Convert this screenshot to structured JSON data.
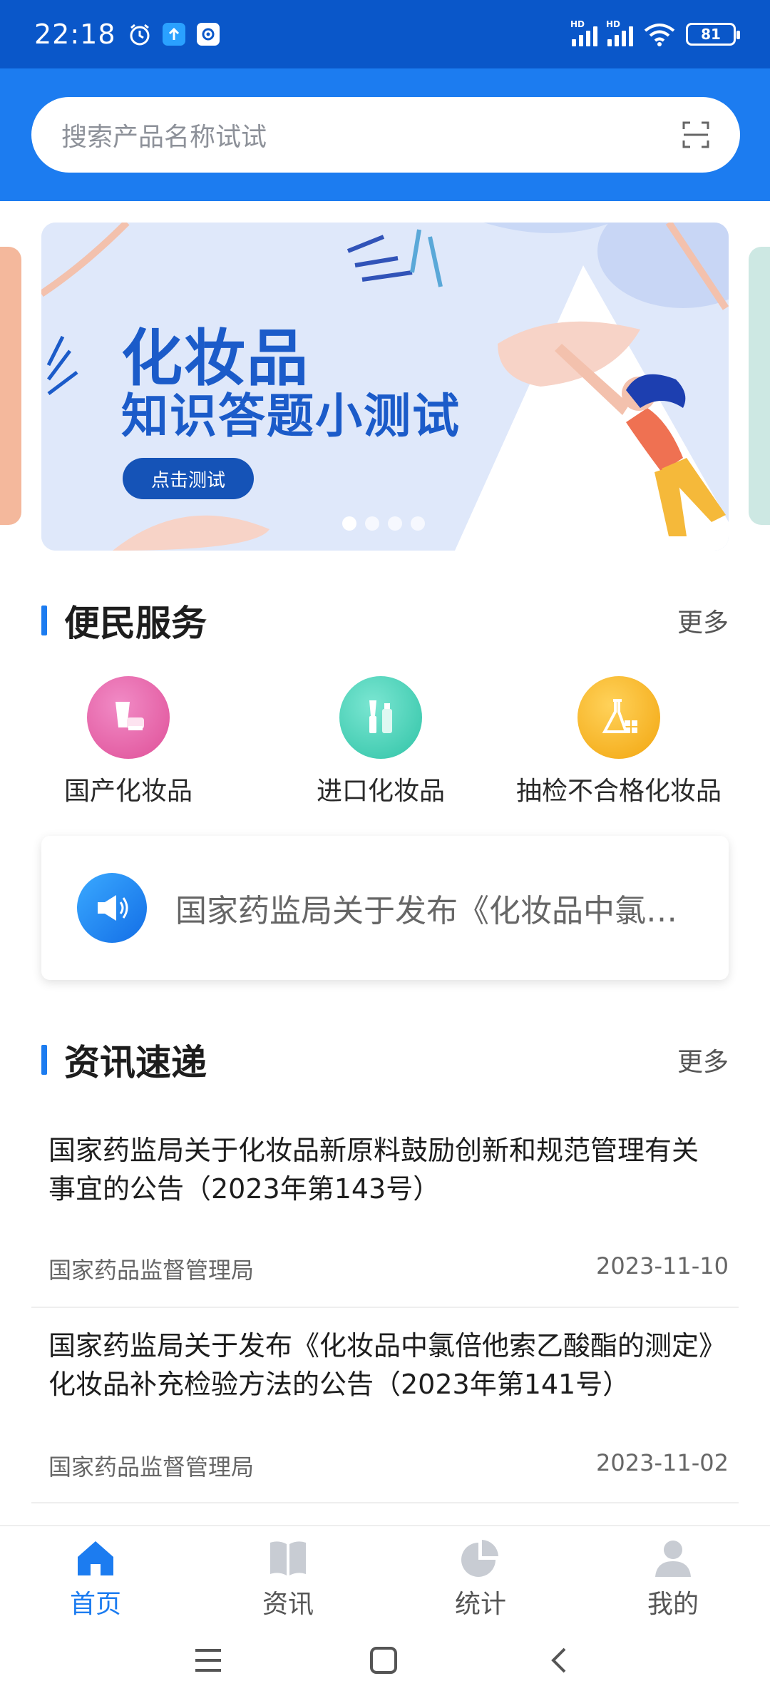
{
  "status_bar": {
    "time": "22:18",
    "battery": "81",
    "signal_label": "HD"
  },
  "search": {
    "placeholder": "搜索产品名称试试",
    "scan_icon": "scan-icon"
  },
  "banner": {
    "title": "化妆品",
    "subtitle": "知识答题小测试",
    "button_label": "点击测试",
    "dots_count": 4,
    "active_dot": 1,
    "colors": {
      "background": "#dfe8fa",
      "title": "#1b5bc9"
    }
  },
  "services_section": {
    "title": "便民服务",
    "more_label": "更多",
    "items": [
      {
        "label": "国产化妆品",
        "icon": "cosmetics-icon",
        "color": "#e45da4"
      },
      {
        "label": "进口化妆品",
        "icon": "brush-bottle-icon",
        "color": "#3fcfb3"
      },
      {
        "label": "抽检不合格化妆品",
        "icon": "flask-icon",
        "color": "#f5b21e"
      }
    ]
  },
  "notice": {
    "text": "国家药监局关于发布《化妆品中氯倍他索乙酸酯的测定》化妆品补充检验方法的公告",
    "icon": "megaphone-icon"
  },
  "news_section": {
    "title": "资讯速递",
    "more_label": "更多",
    "items": [
      {
        "title": "国家药监局关于化妆品新原料鼓励创新和规范管理有关事宜的公告（2023年第143号）",
        "source": "国家药品监督管理局",
        "date": "2023-11-10"
      },
      {
        "title": "国家药监局关于发布《化妆品中氯倍他索乙酸酯的测定》化妆品补充检验方法的公告（2023年第141号）",
        "source": "国家药品监督管理局",
        "date": "2023-11-02"
      }
    ]
  },
  "tabbar": {
    "tabs": [
      {
        "label": "首页",
        "icon": "home-icon",
        "active": true
      },
      {
        "label": "资讯",
        "icon": "book-icon",
        "active": false
      },
      {
        "label": "统计",
        "icon": "pie-chart-icon",
        "active": false
      },
      {
        "label": "我的",
        "icon": "user-icon",
        "active": false
      }
    ],
    "active_color": "#1c7cf0"
  },
  "system_nav": {
    "buttons": [
      "menu-icon",
      "home-square-icon",
      "back-icon"
    ]
  }
}
